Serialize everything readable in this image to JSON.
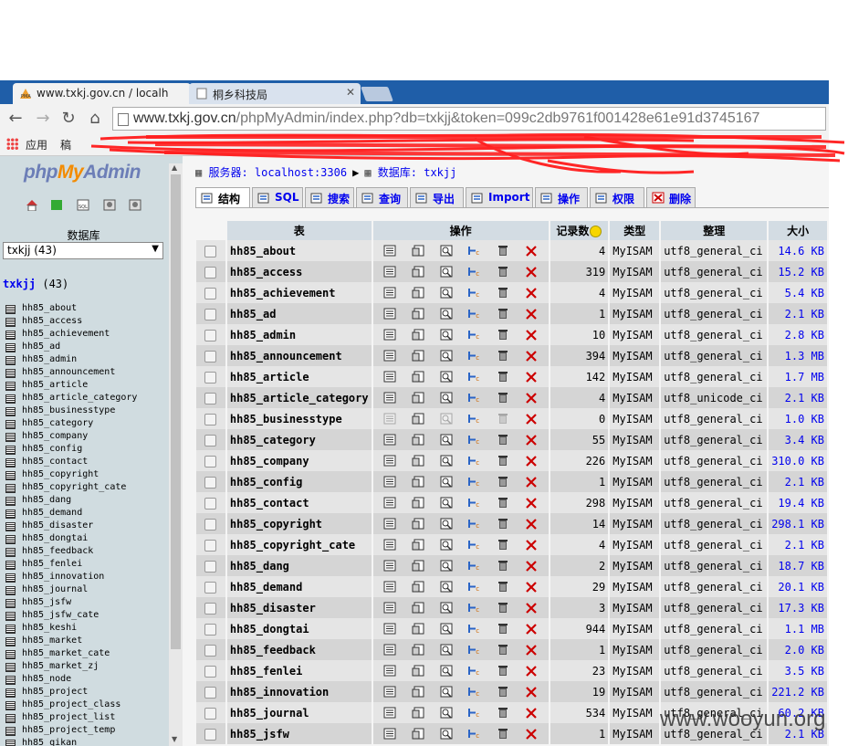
{
  "browser": {
    "tabs": [
      {
        "title": "www.txkj.gov.cn / localh",
        "favicon": "pma-icon",
        "active": true
      },
      {
        "title": "桐乡科技局",
        "favicon": "page-icon",
        "active": false
      }
    ],
    "url": {
      "host": "www.txkj.gov.cn",
      "path": "/phpMyAdmin/index.php?db=txkjj&token=099c2db9761f001428e61e91d3745167"
    },
    "bookmarks": [
      {
        "label": "应用"
      },
      {
        "label": "稿"
      }
    ]
  },
  "left": {
    "logo": {
      "php": "php",
      "my": "My",
      "admin": "Admin"
    },
    "db_label": "数据库",
    "db_select": "txkjj (43)",
    "db_name": "txkjj",
    "db_count": "(43)",
    "tables": [
      "hh85_about",
      "hh85_access",
      "hh85_achievement",
      "hh85_ad",
      "hh85_admin",
      "hh85_announcement",
      "hh85_article",
      "hh85_article_category",
      "hh85_businesstype",
      "hh85_category",
      "hh85_company",
      "hh85_config",
      "hh85_contact",
      "hh85_copyright",
      "hh85_copyright_cate",
      "hh85_dang",
      "hh85_demand",
      "hh85_disaster",
      "hh85_dongtai",
      "hh85_feedback",
      "hh85_fenlei",
      "hh85_innovation",
      "hh85_journal",
      "hh85_jsfw",
      "hh85_jsfw_cate",
      "hh85_keshi",
      "hh85_market",
      "hh85_market_cate",
      "hh85_market_zj",
      "hh85_node",
      "hh85_project",
      "hh85_project_class",
      "hh85_project_list",
      "hh85_project_temp",
      "hh85_qikan"
    ]
  },
  "breadcrumb": {
    "server": "服务器: localhost:3306",
    "database": "数据库: txkjj"
  },
  "ptabs": [
    {
      "label": "结构",
      "icon": "structure-icon",
      "active": true
    },
    {
      "label": "SQL",
      "icon": "sql-icon",
      "active": false
    },
    {
      "label": "搜索",
      "icon": "search-icon",
      "active": false
    },
    {
      "label": "查询",
      "icon": "query-icon",
      "active": false
    },
    {
      "label": "导出",
      "icon": "export-icon",
      "active": false
    },
    {
      "label": "Import",
      "icon": "import-icon",
      "active": false
    },
    {
      "label": "操作",
      "icon": "operations-icon",
      "active": false
    },
    {
      "label": "权限",
      "icon": "privileges-icon",
      "active": false
    },
    {
      "label": "删除",
      "icon": "drop-icon",
      "active": false
    }
  ],
  "table_headers": {
    "table": "表",
    "action": "操作",
    "records": "记录数",
    "type": "类型",
    "collation": "整理",
    "size": "大小"
  },
  "rows": [
    {
      "name": "hh85_about",
      "records": "4",
      "type": "MyISAM",
      "collation": "utf8_general_ci",
      "size": "14.6 KB"
    },
    {
      "name": "hh85_access",
      "records": "319",
      "type": "MyISAM",
      "collation": "utf8_general_ci",
      "size": "15.2 KB"
    },
    {
      "name": "hh85_achievement",
      "records": "4",
      "type": "MyISAM",
      "collation": "utf8_general_ci",
      "size": "5.4 KB"
    },
    {
      "name": "hh85_ad",
      "records": "1",
      "type": "MyISAM",
      "collation": "utf8_general_ci",
      "size": "2.1 KB"
    },
    {
      "name": "hh85_admin",
      "records": "10",
      "type": "MyISAM",
      "collation": "utf8_general_ci",
      "size": "2.8 KB"
    },
    {
      "name": "hh85_announcement",
      "records": "394",
      "type": "MyISAM",
      "collation": "utf8_general_ci",
      "size": "1.3 MB"
    },
    {
      "name": "hh85_article",
      "records": "142",
      "type": "MyISAM",
      "collation": "utf8_general_ci",
      "size": "1.7 MB"
    },
    {
      "name": "hh85_article_category",
      "records": "4",
      "type": "MyISAM",
      "collation": "utf8_unicode_ci",
      "size": "2.1 KB"
    },
    {
      "name": "hh85_businesstype",
      "records": "0",
      "type": "MyISAM",
      "collation": "utf8_general_ci",
      "size": "1.0 KB"
    },
    {
      "name": "hh85_category",
      "records": "55",
      "type": "MyISAM",
      "collation": "utf8_general_ci",
      "size": "3.4 KB"
    },
    {
      "name": "hh85_company",
      "records": "226",
      "type": "MyISAM",
      "collation": "utf8_general_ci",
      "size": "310.0 KB"
    },
    {
      "name": "hh85_config",
      "records": "1",
      "type": "MyISAM",
      "collation": "utf8_general_ci",
      "size": "2.1 KB"
    },
    {
      "name": "hh85_contact",
      "records": "298",
      "type": "MyISAM",
      "collation": "utf8_general_ci",
      "size": "19.4 KB"
    },
    {
      "name": "hh85_copyright",
      "records": "14",
      "type": "MyISAM",
      "collation": "utf8_general_ci",
      "size": "298.1 KB"
    },
    {
      "name": "hh85_copyright_cate",
      "records": "4",
      "type": "MyISAM",
      "collation": "utf8_general_ci",
      "size": "2.1 KB"
    },
    {
      "name": "hh85_dang",
      "records": "2",
      "type": "MyISAM",
      "collation": "utf8_general_ci",
      "size": "18.7 KB"
    },
    {
      "name": "hh85_demand",
      "records": "29",
      "type": "MyISAM",
      "collation": "utf8_general_ci",
      "size": "20.1 KB"
    },
    {
      "name": "hh85_disaster",
      "records": "3",
      "type": "MyISAM",
      "collation": "utf8_general_ci",
      "size": "17.3 KB"
    },
    {
      "name": "hh85_dongtai",
      "records": "944",
      "type": "MyISAM",
      "collation": "utf8_general_ci",
      "size": "1.1 MB"
    },
    {
      "name": "hh85_feedback",
      "records": "1",
      "type": "MyISAM",
      "collation": "utf8_general_ci",
      "size": "2.0 KB"
    },
    {
      "name": "hh85_fenlei",
      "records": "23",
      "type": "MyISAM",
      "collation": "utf8_general_ci",
      "size": "3.5 KB"
    },
    {
      "name": "hh85_innovation",
      "records": "19",
      "type": "MyISAM",
      "collation": "utf8_general_ci",
      "size": "221.2 KB"
    },
    {
      "name": "hh85_journal",
      "records": "534",
      "type": "MyISAM",
      "collation": "utf8_general_ci",
      "size": "60.2 KB"
    },
    {
      "name": "hh85_jsfw",
      "records": "1",
      "type": "MyISAM",
      "collation": "utf8_general_ci",
      "size": "2.1 KB"
    }
  ],
  "watermark": "www.wooyun.org",
  "colors": {
    "tabbar": "#1f5ea8",
    "link": "#0000ee",
    "header": "#d3dce3",
    "drop": "#cc0000"
  }
}
